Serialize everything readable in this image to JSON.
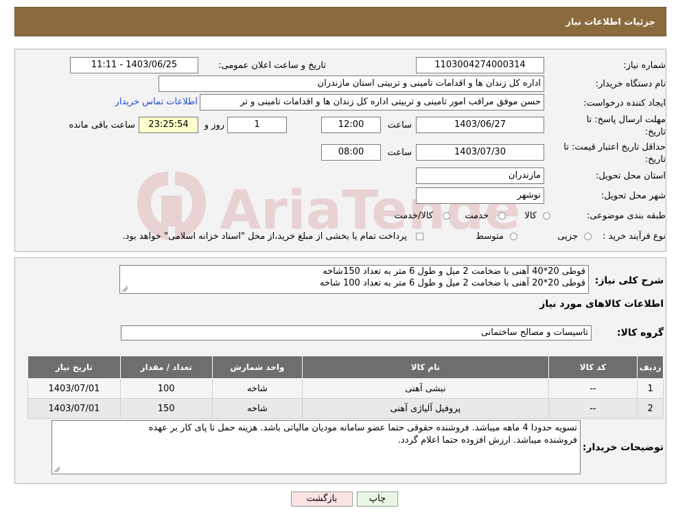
{
  "header": {
    "title": "جزئیات اطلاعات نیاز"
  },
  "form": {
    "need_number_label": "شماره نیاز:",
    "need_number": "1103004274000314",
    "announce_label": "تاریخ و ساعت اعلان عمومی:",
    "announce_value": "1403/06/25 - 11:11",
    "buyer_org_label": "نام دستگاه خریدار:",
    "buyer_org": "اداره کل زندان ها و اقدامات تامینی و تربیتی استان مازندران",
    "requester_label": "ایجاد کننده درخواست:",
    "requester": "حسن موفق مراقب امور تامینی و تربیتی اداره کل زندان ها و اقدامات تامینی و تر",
    "contact_link": "اطلاعات تماس خریدار",
    "deadline_label_1": "مهلت ارسال پاسخ: تا",
    "deadline_label_2": "تاریخ:",
    "deadline_date": "1403/06/27",
    "time_label": "ساعت",
    "deadline_time": "12:00",
    "days_value": "1",
    "days_label": "روز و",
    "remaining_time": "23:25:54",
    "remaining_label": "ساعت باقی مانده",
    "validity_label_1": "حداقل تاریخ اعتبار قیمت: تا",
    "validity_label_2": "تاریخ:",
    "validity_date": "1403/07/30",
    "validity_time_label": "ساعت",
    "validity_time": "08:00",
    "province_label": "استان محل تحویل:",
    "province": "مازندران",
    "city_label": "شهر محل تحویل:",
    "city": "نوشهر",
    "category_label": "طبقه بندی موضوعی:",
    "category_options": [
      "کالا",
      "خدمت",
      "کالا/خدمت"
    ],
    "process_label": "نوع فرآیند خرید :",
    "process_options": [
      "جزیی",
      "متوسط"
    ],
    "process_note": "پرداخت تمام یا بخشی از مبلغ خرید،از محل \"اسناد خزانه اسلامی\" خواهد بود."
  },
  "description": {
    "label": "شرح کلی نیاز:",
    "line1": "قوطی 20*40 آهنی با ضخامت 2 میل و طول 6 متر به تعداد 150شاخه",
    "line2": "قوطی 20*20 آهنی با ضخامت 2 میل و طول 6 متر به تعداد 100 شاخه"
  },
  "goods": {
    "section_title": "اطلاعات کالاهای مورد نیاز",
    "group_label": "گروه کالا:",
    "group_value": "تاسیسات و مصالح ساختمانی",
    "columns": [
      "ردیف",
      "کد کالا",
      "نام کالا",
      "واحد شمارش",
      "تعداد / مقدار",
      "تاریخ نیاز"
    ],
    "rows": [
      [
        "1",
        "--",
        "نبشی آهنی",
        "شاخه",
        "100",
        "1403/07/01"
      ],
      [
        "2",
        "--",
        "پروفیل آلیاژی آهنی",
        "شاخه",
        "150",
        "1403/07/01"
      ]
    ]
  },
  "buyer_notes": {
    "label": "توضیحات خریدار:",
    "line1": "تسویه حدودا 4 ماهه میباشد. فروشنده حقوقی حتما عضو سامانه مودیان مالیاتی باشد. هزینه حمل تا پای کار بر عهده",
    "line2": "فروشنده میباشد. ارزش افزوده حتما اعلام گردد."
  },
  "buttons": {
    "print": "چاپ",
    "back": "بازگشت"
  },
  "watermark": {
    "text": "AriaTender.neT"
  },
  "colors": {
    "header_bg": "#8b6b3d",
    "table_header_bg": "#6e6e6e",
    "yellow_field": "#ffffcc",
    "link": "#1f4fd6",
    "back_button": "#fbe3e3",
    "print_button": "#e8f7e3"
  }
}
